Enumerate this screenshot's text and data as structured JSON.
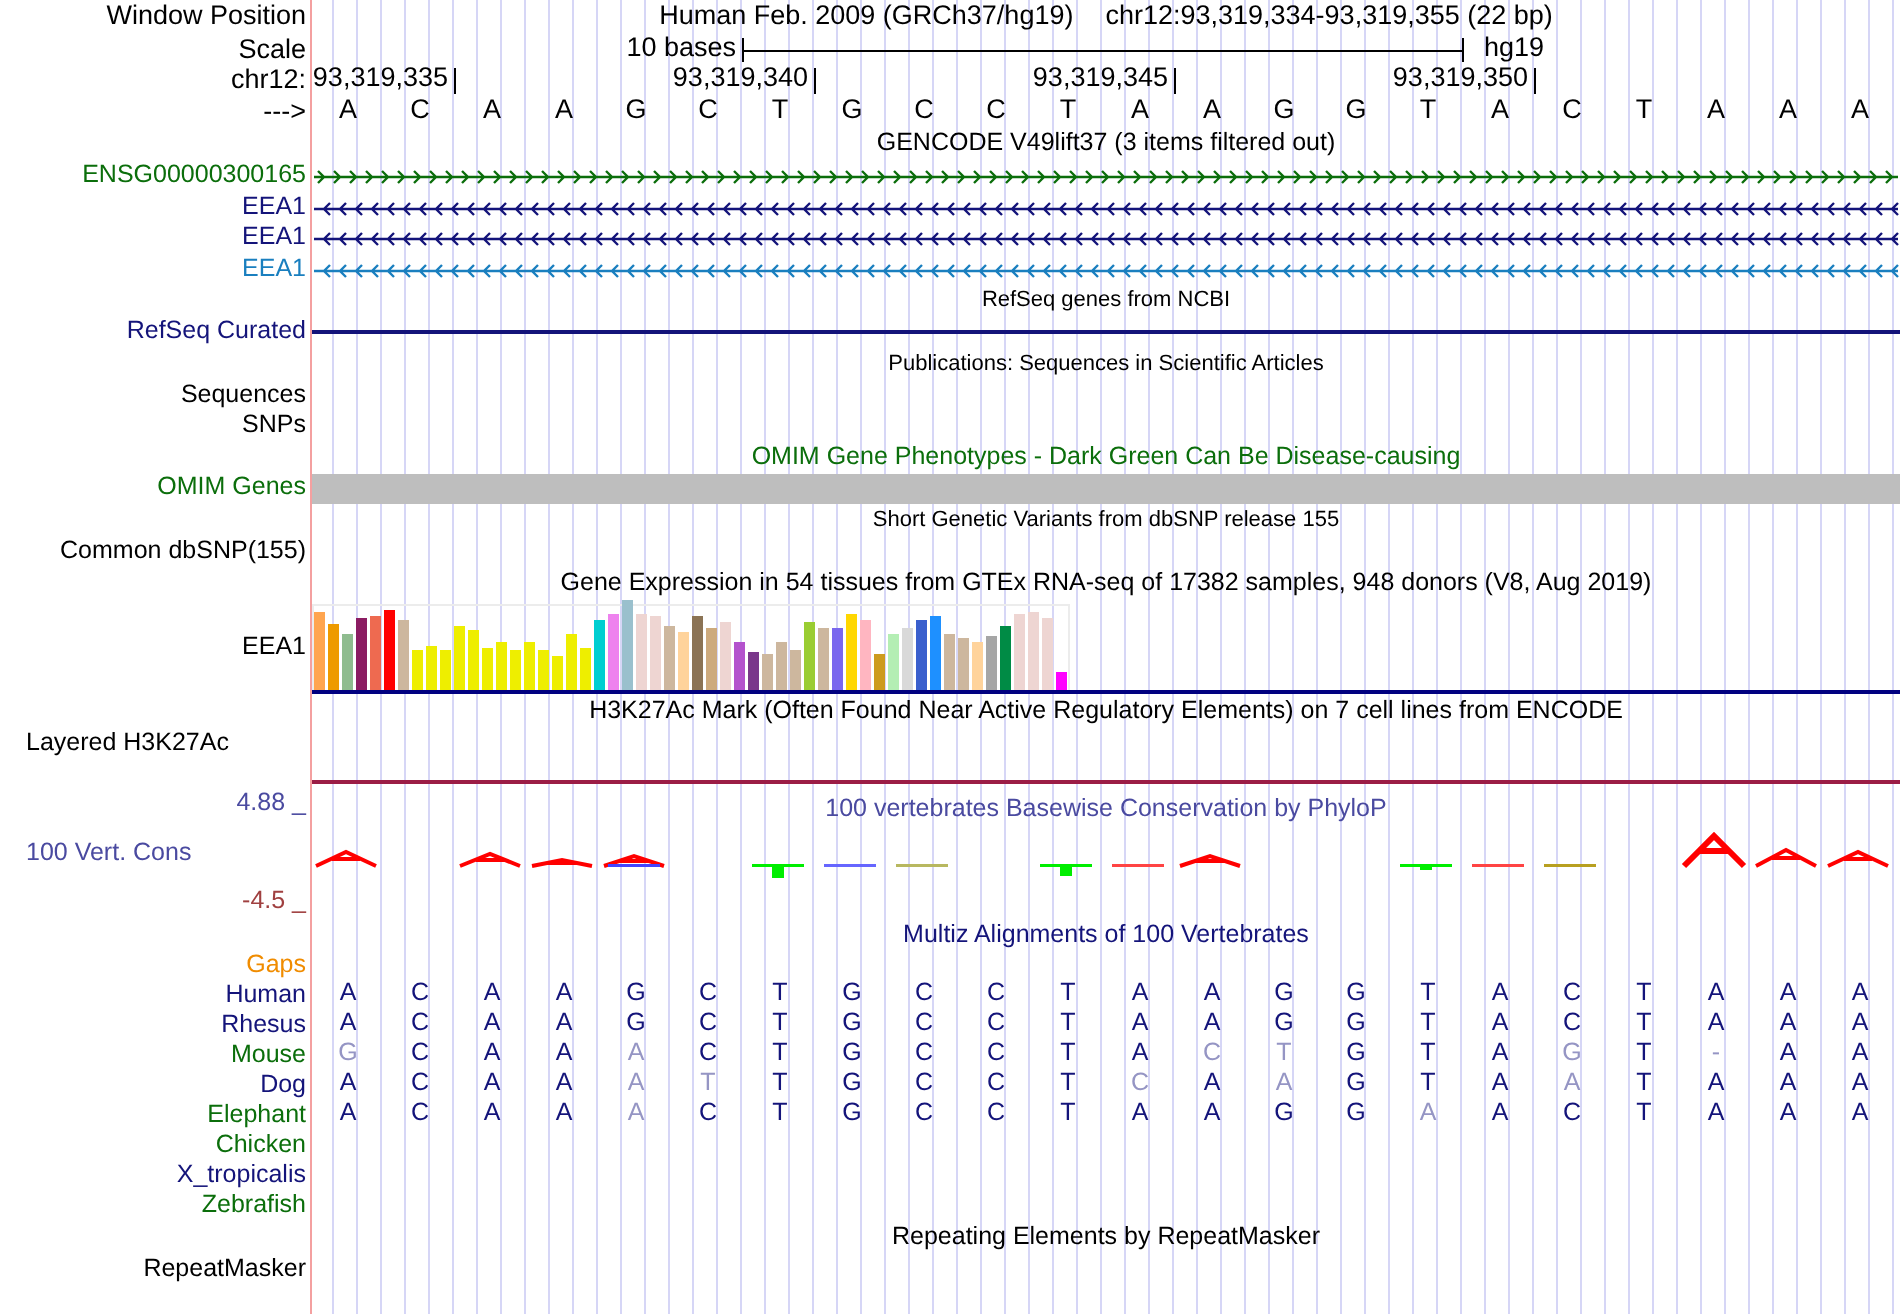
{
  "header": {
    "position_label": "Window Position",
    "assembly": "Human Feb. 2009 (GRCh37/hg19)",
    "position": "chr12:93,319,334-93,319,355 (22 bp)",
    "scale_label": "Scale",
    "scale_text": "10 bases",
    "scale_db": "hg19",
    "chrom_label": "chr12:",
    "ticks": [
      "93,319,335",
      "93,319,340",
      "93,319,345",
      "93,319,350"
    ],
    "strand_label": "--->",
    "bases": [
      "A",
      "C",
      "A",
      "A",
      "G",
      "C",
      "T",
      "G",
      "C",
      "C",
      "T",
      "A",
      "A",
      "G",
      "G",
      "T",
      "A",
      "C",
      "T",
      "A",
      "A",
      "A"
    ]
  },
  "tracks": [
    {
      "kind": "gencode",
      "title": "GENCODE V49lift37 (3 items filtered out)",
      "items": [
        {
          "label": "ENSG00000300165",
          "color": "#0b6e0b",
          "kind": "forward"
        },
        {
          "label": "EEA1",
          "color": "#14147a",
          "kind": "reverse"
        },
        {
          "label": "EEA1",
          "color": "#14147a",
          "kind": "reverse"
        },
        {
          "label": "EEA1",
          "color": "#1a7fbf",
          "kind": "reverse"
        }
      ]
    },
    {
      "kind": "refseq",
      "title": "RefSeq genes from NCBI",
      "label": "RefSeq Curated",
      "color": "#14147a"
    },
    {
      "kind": "publications",
      "title": "Publications: Sequences in Scientific Articles",
      "labels": [
        "Sequences",
        "SNPs"
      ]
    },
    {
      "kind": "omim",
      "title": "OMIM Gene Phenotypes - Dark Green Can Be Disease-causing",
      "label": "OMIM Genes",
      "color": "#0b6e0b"
    },
    {
      "kind": "dbsnp",
      "title": "Short Genetic Variants from dbSNP release 155",
      "label": "Common dbSNP(155)"
    },
    {
      "kind": "gtex",
      "title": "Gene Expression in 54 tissues from GTEx RNA-seq of 17382 samples, 948 donors (V8, Aug 2019)",
      "label": "EEA1"
    },
    {
      "kind": "h3k27ac",
      "title": "H3K27Ac Mark (Often Found Near Active Regulatory Elements) on 7 cell lines from ENCODE",
      "label": "Layered H3K27Ac"
    },
    {
      "kind": "phylop",
      "title": "100 vertebrates Basewise Conservation by PhyloP",
      "label": "100 Vert. Cons",
      "color": "#4a4aa0",
      "max": "4.88 _",
      "min": "-4.5 _"
    },
    {
      "kind": "multiz",
      "title": "Multiz Alignments of 100 Vertebrates",
      "color": "#14147a",
      "gaps": {
        "label": "Gaps",
        "color": "#f08c00"
      },
      "species": [
        {
          "name": "Human",
          "color": "#14147a",
          "bases": [
            "A",
            "C",
            "A",
            "A",
            "G",
            "C",
            "T",
            "G",
            "C",
            "C",
            "T",
            "A",
            "A",
            "G",
            "G",
            "T",
            "A",
            "C",
            "T",
            "A",
            "A",
            "A"
          ]
        },
        {
          "name": "Rhesus",
          "color": "#14147a",
          "bases": [
            "A",
            "C",
            "A",
            "A",
            "G",
            "C",
            "T",
            "G",
            "C",
            "C",
            "T",
            "A",
            "A",
            "G",
            "G",
            "T",
            "A",
            "C",
            "T",
            "A",
            "A",
            "A"
          ]
        },
        {
          "name": "Mouse",
          "color": "#0b6e0b",
          "bases": [
            "G",
            "C",
            "A",
            "A",
            "A",
            "C",
            "T",
            "G",
            "C",
            "C",
            "T",
            "A",
            "C",
            "T",
            "G",
            "T",
            "A",
            "G",
            "T",
            "-",
            "A",
            "A"
          ]
        },
        {
          "name": "Dog",
          "color": "#14147a",
          "bases": [
            "A",
            "C",
            "A",
            "A",
            "A",
            "T",
            "T",
            "G",
            "C",
            "C",
            "T",
            "C",
            "A",
            "A",
            "G",
            "T",
            "A",
            "A",
            "T",
            "A",
            "A",
            "A"
          ]
        },
        {
          "name": "Elephant",
          "color": "#0b6e0b",
          "bases": [
            "A",
            "C",
            "A",
            "A",
            "A",
            "C",
            "T",
            "G",
            "C",
            "C",
            "T",
            "A",
            "A",
            "G",
            "G",
            "A",
            "A",
            "C",
            "T",
            "A",
            "A",
            "A"
          ]
        },
        {
          "name": "Chicken",
          "color": "#0b6e0b"
        },
        {
          "name": "X_tropicalis",
          "color": "#14147a"
        },
        {
          "name": "Zebrafish",
          "color": "#0b6e0b"
        }
      ]
    },
    {
      "kind": "rmsk",
      "title": "Repeating Elements by RepeatMasker",
      "label": "RepeatMasker"
    }
  ]
}
